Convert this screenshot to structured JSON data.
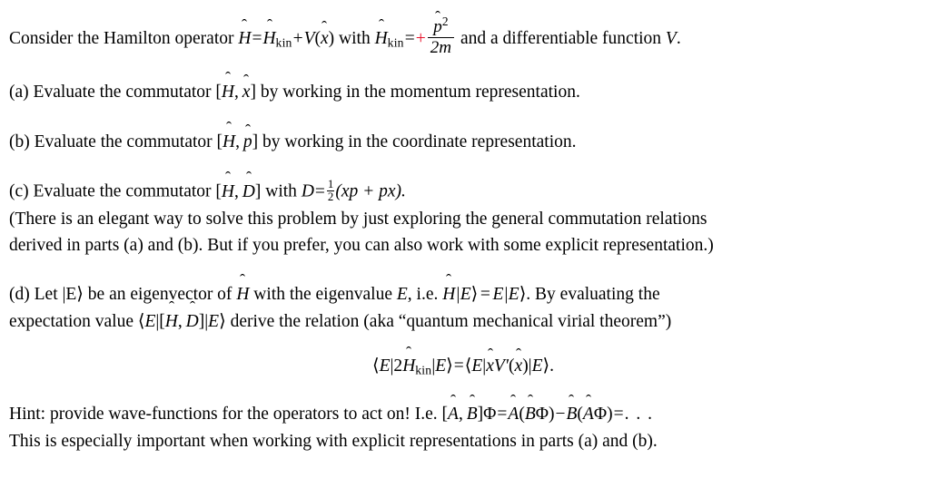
{
  "document": {
    "type": "physics-problem-set",
    "background_color": "#ffffff",
    "text_color": "#000000",
    "accent_color": "#e8102a"
  },
  "intro": {
    "text_1": "Consider the Hamilton operator",
    "H_symbol": "H",
    "equals": "=",
    "Hkin_symbol": "H",
    "kin_subscript": "kin",
    "plus_V": "+",
    "V_symbol": "V",
    "open_paren": "(",
    "x_symbol": "x",
    "close_paren": ")",
    "text_with": "with",
    "fraction_numerator": "p",
    "fraction_numerator_exponent": "2",
    "fraction_denominator": "2m",
    "plus_sign": "+",
    "text_2": "and a differentiable function",
    "V_end": "V",
    "period": "."
  },
  "part_a": {
    "label": "(a)",
    "text_1": "Evaluate the commutator",
    "commutator": "[H, x]",
    "text_2": "by working in the momentum representation."
  },
  "part_b": {
    "label": "(b)",
    "text_1": "Evaluate the commutator",
    "commutator": "[H, p]",
    "text_2": "by working in the coordinate representation."
  },
  "part_c": {
    "label": "(c)",
    "text_1": "Evaluate the commutator",
    "commutator": "[H, D]",
    "text_2": "with",
    "D_symbol": "D",
    "equals": "=",
    "half_numerator": "1",
    "half_denominator": "2",
    "definition": "(xp + px).",
    "note_line_1": "(There is an elegant way to solve this problem by just exploring the general commutation relations",
    "note_line_2": "derived in parts (a) and (b). But if you prefer, you can also work with some explicit representation.)"
  },
  "part_d": {
    "label": "(d)",
    "text_1": "Let",
    "ket_E": "|E⟩",
    "text_2": "be an eigenvector of",
    "H_symbol": "H",
    "text_3": "with the eigenvalue",
    "E_symbol": "E",
    "text_4": ", i.e.",
    "eigen_equation": "H|E⟩ = E|E⟩.",
    "text_5": "By evaluating the",
    "line2_text_1": "expectation value",
    "expectation": "⟨E|[H, D]|E⟩",
    "line2_text_2": "derive the relation (aka “quantum mechanical virial theorem”)"
  },
  "equation": {
    "lhs_open": "⟨E|2",
    "lhs_H": "H",
    "lhs_sub": "kin",
    "lhs_close": "|E⟩",
    "equals": "=",
    "rhs": "⟨E|xV′(x)|E⟩",
    "period": "."
  },
  "hint": {
    "label": "Hint:",
    "text_1": "provide wave-functions for the operators to act on! I.e.",
    "formula": "[A, B]Φ = A(BΦ) − B(AΦ) = …",
    "line_2": "This is especially important when working with explicit representations in parts (a) and (b)."
  }
}
